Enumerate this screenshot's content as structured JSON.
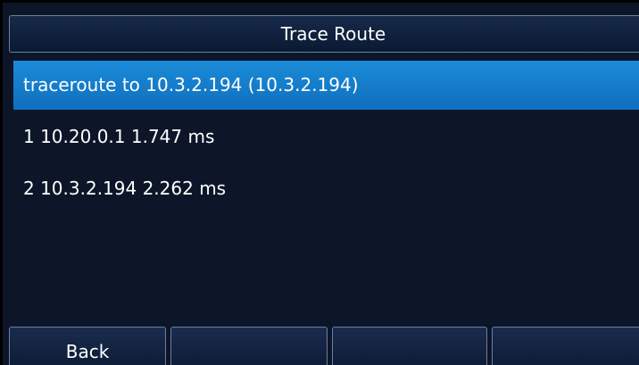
{
  "title": "Trace Route",
  "rows": [
    {
      "text": "traceroute to 10.3.2.194 (10.3.2.194)",
      "selected": true
    },
    {
      "text": "1  10.20.0.1  1.747 ms",
      "selected": false
    },
    {
      "text": "2  10.3.2.194  2.262 ms",
      "selected": false
    }
  ],
  "softkeys": [
    "Back",
    "",
    "",
    ""
  ],
  "colors": {
    "background": "#0c1628",
    "selection": "#1b8bd8",
    "text": "#ffffff"
  }
}
